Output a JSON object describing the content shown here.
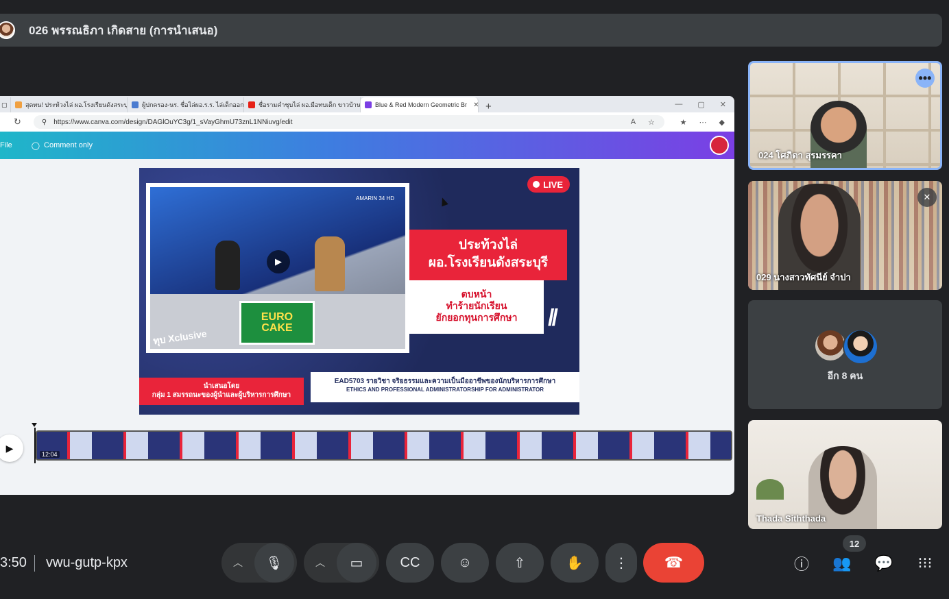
{
  "presenter": {
    "title": "026 พรรณธิภา เกิดสาย (การนำเสนอ)"
  },
  "browser": {
    "tabs": [
      {
        "label": "สุดทน! ประท้วงไล่ ผอ.โรงเรียนดังสระบุรี",
        "favicon_color": "#f0a040"
      },
      {
        "label": "ผู้ปกครอง-นร. ชื่อไล่ผอ.ร.ร. ไล่เด็กออกไม่",
        "favicon_color": "#4a7bd0"
      },
      {
        "label": "ชื่อรามคำชุบไล่ ผอ.มือทบเด็ก ขาวบ้านล",
        "favicon_color": "#e62117"
      },
      {
        "label": "Blue & Red Modern Geometric Br",
        "favicon_color": "#7b3fe4"
      }
    ],
    "url": "https://www.canva.com/design/DAGlOuYC3g/1_sVayGhmU73znL1NNiuvg/edit"
  },
  "canva": {
    "file_label": "File",
    "comment_label": "Comment only"
  },
  "slide": {
    "live_label": "LIVE",
    "channel": "AMARIN 34 HD",
    "headline_1": "ประท้วงไล่",
    "headline_2": "ผอ.โรงเรียนดังสระบุรี",
    "sub_1": "ตบหน้า",
    "sub_2": "ทำร้ายนักเรียน",
    "sub_3": "ยักยอกทุนการศึกษา",
    "desk_brand_1": "EURO",
    "desk_brand_2": "CAKE",
    "show_logo": "ทุบ Xclusive",
    "presented_by": "นำเสนอโดย",
    "group": "กลุ่ม 1 สมรรถนะของผู้นำและผู้บริหารการศึกษา",
    "course": "EAD5703 รายวิชา จริยธรรมและความเป็นมืออาชีพของนักบริหารการศึกษา",
    "course_en": "ETHICS AND PROFESSIONAL ADMINISTRATORSHIP FOR ADMINISTRATOR"
  },
  "timeline": {
    "time": "12:04"
  },
  "participants": [
    {
      "name": "024 โศภิตา สุรมรรคา"
    },
    {
      "name": "029 นางสาวทัศนีย์ จำปา",
      "muted": true
    },
    {
      "name": "Thada Siththada"
    }
  ],
  "others": {
    "label": "อีก 8 คน"
  },
  "bottom": {
    "clock": "3:50",
    "meet_code": "vwu-gutp-kpx",
    "people_count": "12"
  }
}
